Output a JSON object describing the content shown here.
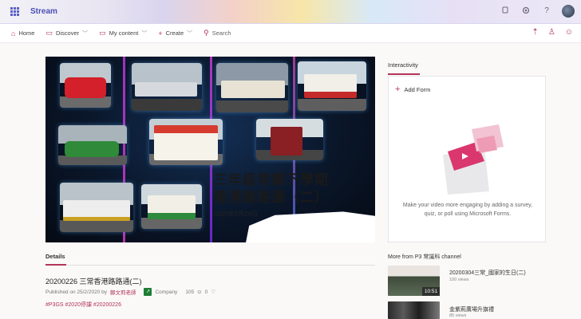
{
  "app": {
    "name": "Stream"
  },
  "appbar_icons": [
    "notification-icon",
    "settings-icon",
    "help-icon",
    "avatar"
  ],
  "nav": {
    "home": "Home",
    "discover": "Discover",
    "my_content": "My content",
    "create": "Create",
    "search_placeholder": "Search"
  },
  "nav_right_icons": [
    "upload-icon",
    "person-icon",
    "smiley-icon"
  ],
  "video": {
    "title_line1": "三年級常識下學期",
    "title_line2": "香港路路通（二）",
    "date": "2020年2月26日"
  },
  "details": {
    "heading": "Details",
    "title": "20200226 三常香港路路通(二)",
    "published": "Published on 25/2/2020 by",
    "author": "鄭文莉老師",
    "visibility": "Company",
    "views": "105",
    "likes": "0",
    "tags": "#P3GS #2020停課 #20200226"
  },
  "interactivity": {
    "heading": "Interactivity",
    "add_form": "Add Form",
    "description": "Make your video more engaging by adding a survey, quiz, or poll using Microsoft Forms."
  },
  "more_from": {
    "heading": "More from P3 常識科 channel",
    "items": [
      {
        "title": "20200304三常_國家的生日(二)",
        "views": "100 views",
        "duration": "10:51"
      },
      {
        "title": "金紫荊廣場升旗禮",
        "views": "85 views"
      }
    ]
  },
  "colors": {
    "accent": "#b4345a",
    "brand": "#4b4fb6"
  }
}
